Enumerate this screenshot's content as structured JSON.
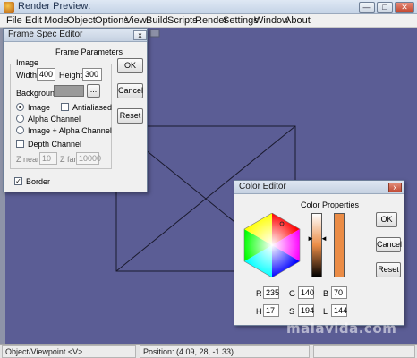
{
  "window": {
    "title": "Render Preview:"
  },
  "menu": [
    "File",
    "Edit",
    "Mode",
    "Object",
    "Options",
    "View",
    "Build",
    "Scripts",
    "Render",
    "Settings",
    "Window",
    "About"
  ],
  "frame_spec": {
    "title": "Frame Spec Editor",
    "heading": "Frame Parameters",
    "group_label": "Image",
    "width_label": "Width:",
    "width_value": "400",
    "height_label": "Height:",
    "height_value": "300",
    "background_label": "Background:",
    "background_color": "#9a9a9a",
    "browse_label": "...",
    "radio_image": "Image",
    "radio_alpha": "Alpha Channel",
    "radio_image_alpha": "Image + Alpha Channel",
    "antialiased_label": "Antialiased",
    "depth_label": "Depth Channel",
    "znear_label": "Z near:",
    "znear_value": "10",
    "zfar_label": "Z far:",
    "zfar_value": "10000",
    "border_label": "Border",
    "ok_label": "OK",
    "cancel_label": "Cancel",
    "reset_label": "Reset",
    "close_label": "x"
  },
  "color_editor": {
    "title": "Color Editor",
    "heading": "Color Properties",
    "r_label": "R",
    "r_value": "235",
    "g_label": "G",
    "g_value": "140",
    "b_label": "B",
    "b_value": "70",
    "h_label": "H",
    "h_value": "17",
    "s_label": "S",
    "s_value": "194",
    "l_label": "L",
    "l_value": "144",
    "swatch_color": "#eb8c46",
    "ok_label": "OK",
    "cancel_label": "Cancel",
    "reset_label": "Reset",
    "close_label": "x"
  },
  "status": {
    "mode": "Object/Viewpoint  <V>",
    "position": "Position: (4.09, 28, -1.33)"
  },
  "watermark": "malavida.com",
  "colors": {
    "viewport": "#5b5d95",
    "accent": "#eb8c46"
  }
}
